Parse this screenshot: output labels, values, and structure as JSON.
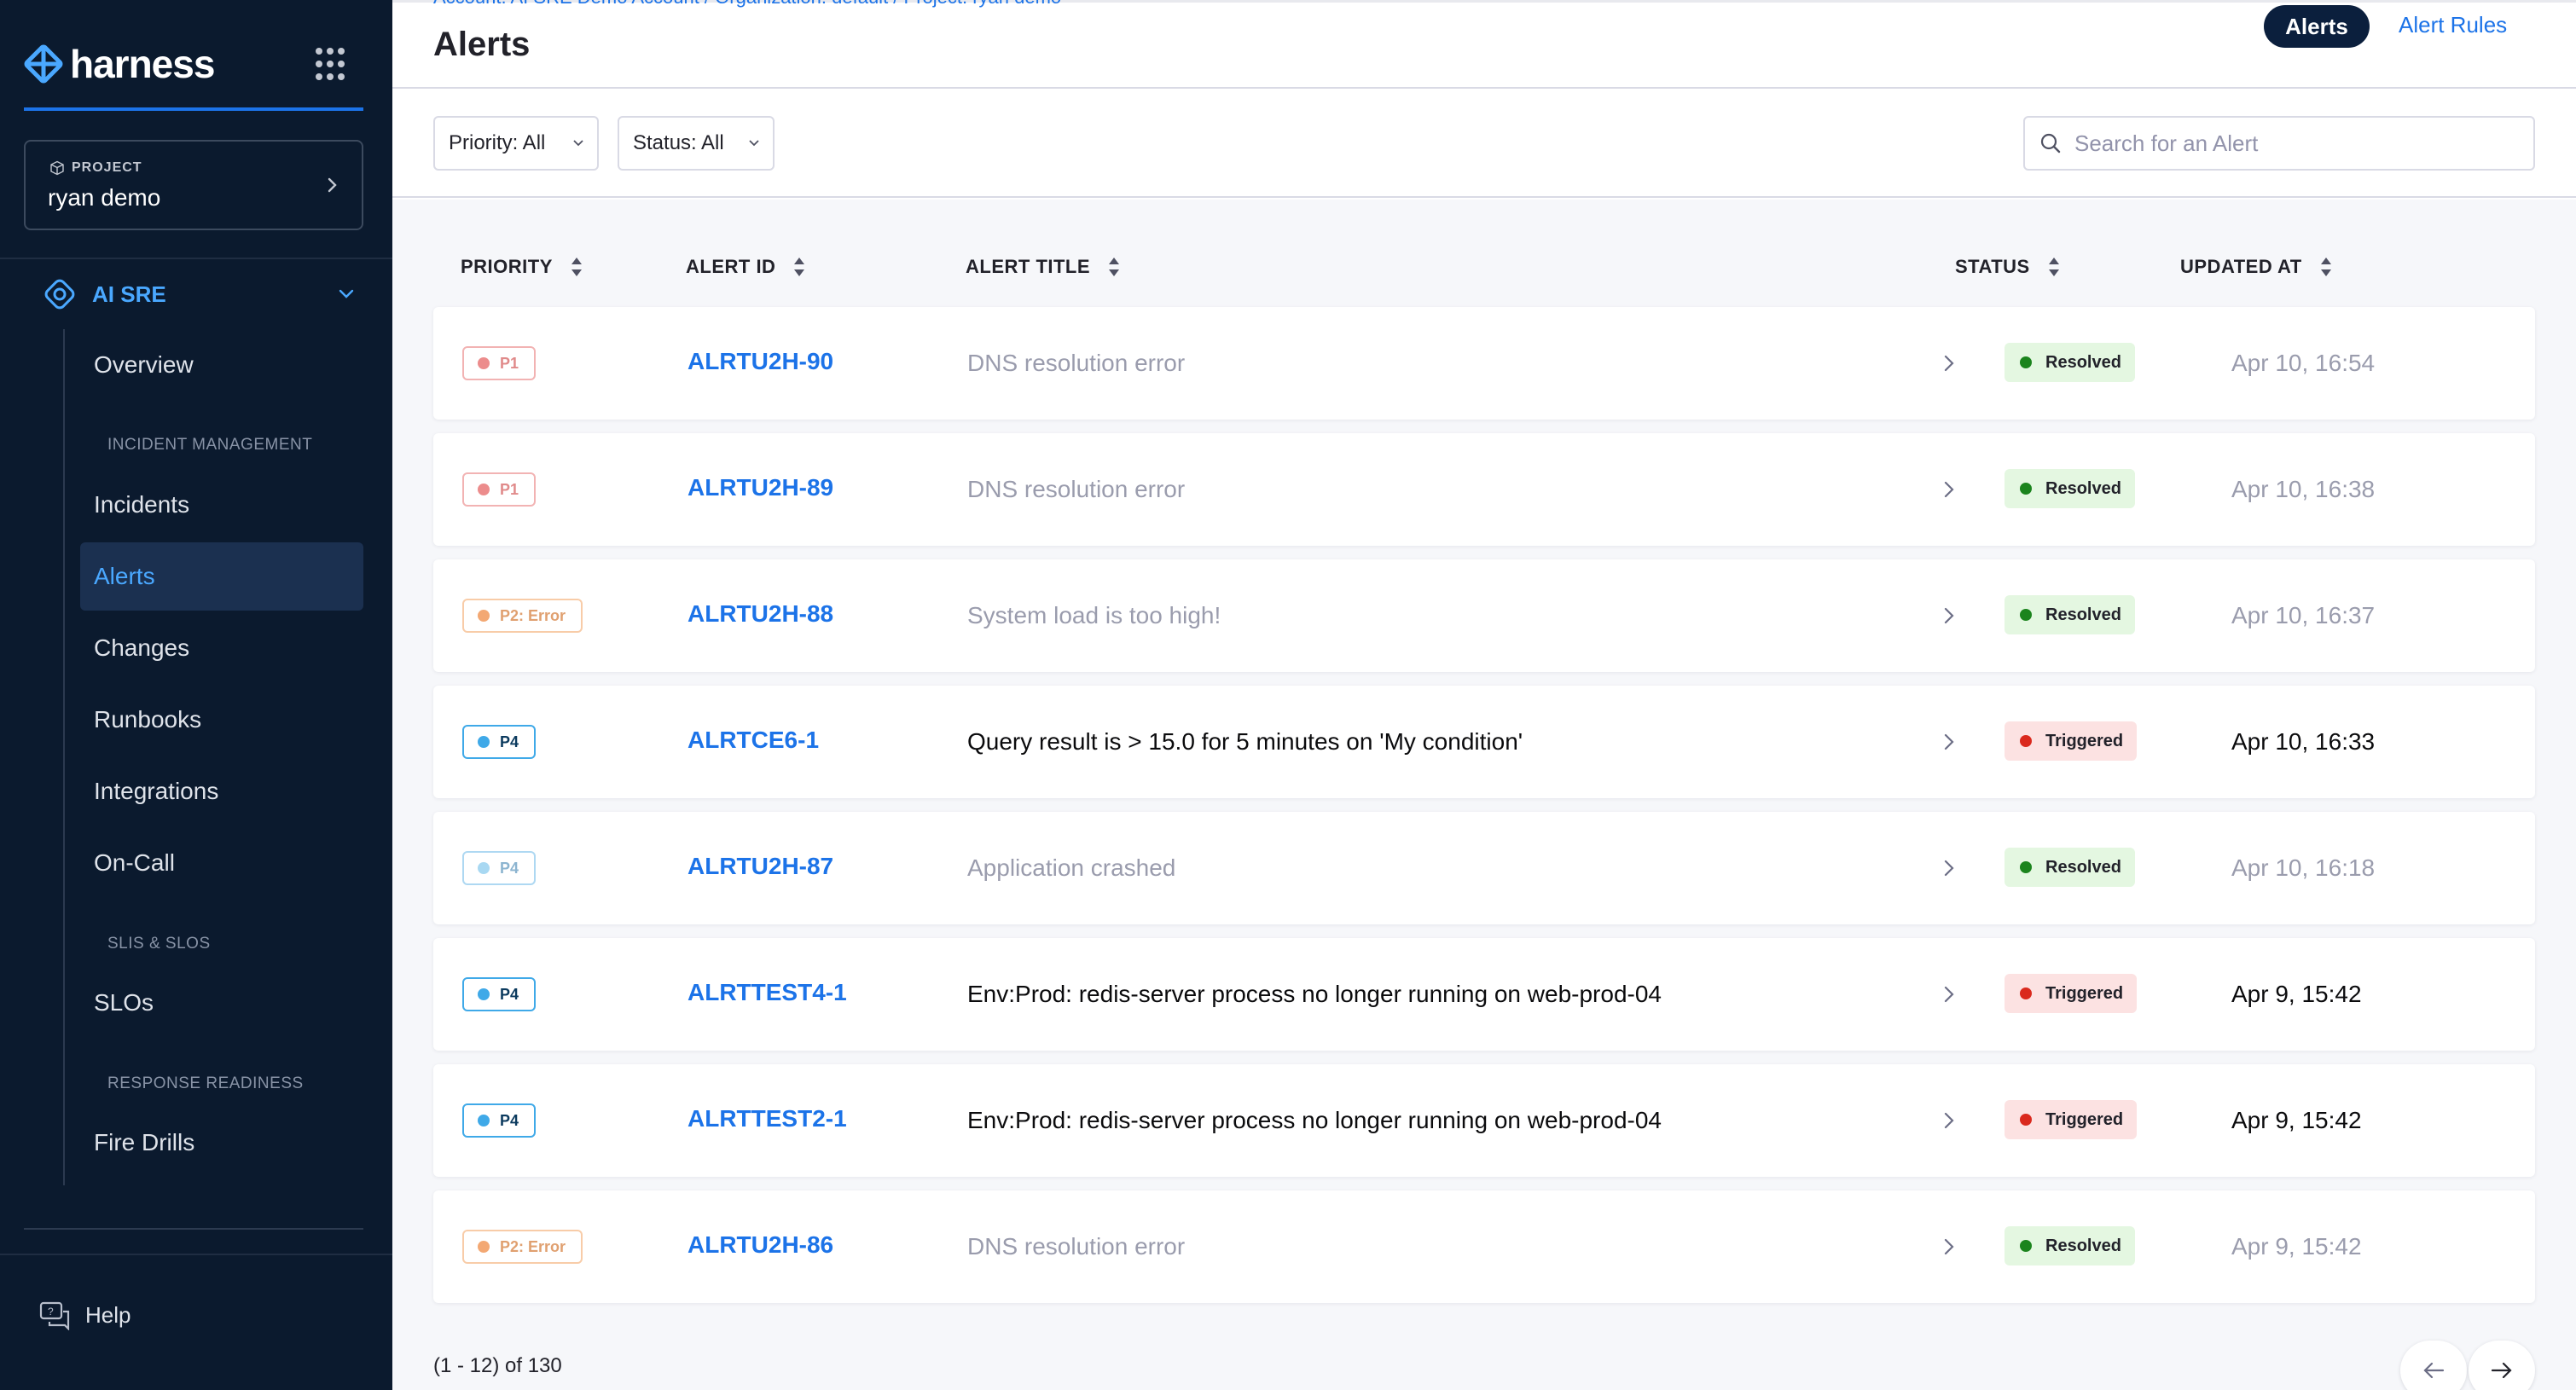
{
  "sidebar": {
    "brand": "harness",
    "project": {
      "label": "PROJECT",
      "name": "ryan demo"
    },
    "module": {
      "label": "AI SRE"
    },
    "items": [
      {
        "label": "Overview",
        "active": false
      },
      {
        "label": "Incidents",
        "active": false
      },
      {
        "label": "Alerts",
        "active": true
      },
      {
        "label": "Changes",
        "active": false
      },
      {
        "label": "Runbooks",
        "active": false
      },
      {
        "label": "Integrations",
        "active": false
      },
      {
        "label": "On-Call",
        "active": false
      },
      {
        "label": "SLOs",
        "active": false
      },
      {
        "label": "Fire Drills",
        "active": false
      }
    ],
    "sections": {
      "incident_management": "INCIDENT MANAGEMENT",
      "slis_slos": "SLIS & SLOS",
      "response_readiness": "RESPONSE READINESS"
    },
    "help": "Help"
  },
  "header": {
    "breadcrumb": "Account: AI SRE Demo Account  /  Organization: default  /  Project: ryan demo",
    "title": "Alerts",
    "tabs": [
      {
        "label": "Alerts",
        "active": true
      },
      {
        "label": "Alert Rules",
        "active": false
      }
    ]
  },
  "filters": {
    "priority": "Priority: All",
    "status": "Status: All",
    "search_placeholder": "Search for an Alert"
  },
  "table": {
    "columns": [
      "PRIORITY",
      "ALERT ID",
      "ALERT TITLE",
      "STATUS",
      "UPDATED AT"
    ],
    "rows": [
      {
        "priority": "P1",
        "id": "ALRTU2H-90",
        "title": "DNS resolution error",
        "status": "Resolved",
        "updated": "Apr 10, 16:54"
      },
      {
        "priority": "P1",
        "id": "ALRTU2H-89",
        "title": "DNS resolution error",
        "status": "Resolved",
        "updated": "Apr 10, 16:38"
      },
      {
        "priority": "P2: Error",
        "id": "ALRTU2H-88",
        "title": "System load is too high!",
        "status": "Resolved",
        "updated": "Apr 10, 16:37"
      },
      {
        "priority": "P4",
        "id": "ALRTCE6-1",
        "title": "Query result is > 15.0 for 5 minutes on 'My condition'",
        "status": "Triggered",
        "updated": "Apr 10, 16:33"
      },
      {
        "priority": "P4",
        "id": "ALRTU2H-87",
        "title": "Application crashed",
        "status": "Resolved",
        "updated": "Apr 10, 16:18"
      },
      {
        "priority": "P4",
        "id": "ALRTTEST4-1",
        "title": "Env:Prod: redis-server process no longer running on web-prod-04",
        "status": "Triggered",
        "updated": "Apr 9, 15:42"
      },
      {
        "priority": "P4",
        "id": "ALRTTEST2-1",
        "title": "Env:Prod: redis-server process no longer running on web-prod-04",
        "status": "Triggered",
        "updated": "Apr 9, 15:42"
      },
      {
        "priority": "P2: Error",
        "id": "ALRTU2H-86",
        "title": "DNS resolution error",
        "status": "Resolved",
        "updated": "Apr 9, 15:42"
      }
    ]
  },
  "pagination": {
    "text": "(1 - 12) of 130"
  },
  "colors": {
    "sidebar_bg": "#0b1a2e",
    "accent": "#1c73e8",
    "p1": "#e76f6f",
    "p2": "#f3a873",
    "p4": "#3fa9e8",
    "resolved_bg": "#e4f7e1",
    "resolved_dot": "#1b841d",
    "triggered_bg": "#fce2e2",
    "triggered_dot": "#da291d"
  }
}
